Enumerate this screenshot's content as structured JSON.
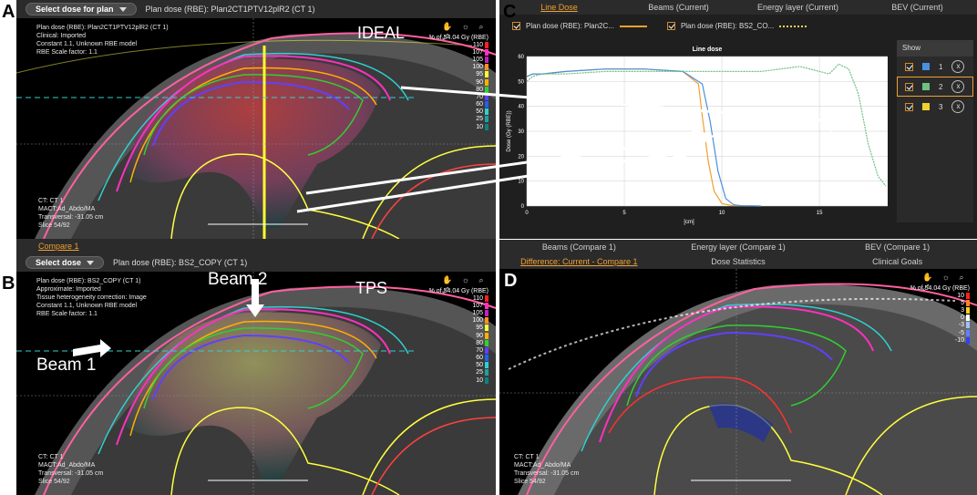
{
  "panel_letters": {
    "a": "A",
    "b": "B",
    "c": "C",
    "d": "D"
  },
  "panel_a": {
    "select_button": "Select dose for plan",
    "dose_title": "Plan dose (RBE): Plan2CT1PTV12plR2 (CT 1)",
    "info_lines": [
      "Plan dose (RBE): Plan2CT1PTV12plR2 (CT 1)",
      "Clinical: Imported",
      "Constant 1.1, Unknown RBE model",
      "RBE Scale factor: 1.1"
    ],
    "label": "IDEAL",
    "percent_of": "% of 54.04 Gy (RBE)",
    "bottom_lines": [
      "CT: CT 1",
      "MACT:Ad_Abdo/MA",
      "Transversal: -31.05 cm",
      "Slice 54/92"
    ]
  },
  "panel_b": {
    "compare_tab": "Compare 1",
    "select_button": "Select dose",
    "dose_title": "Plan dose (RBE): BS2_COPY (CT 1)",
    "info_lines": [
      "Plan dose (RBE): BS2_COPY (CT 1)",
      "Approximate: Imported",
      "Tissue heterogeneity correction: Image",
      "Constant 1.1, Unknown RBE model",
      "RBE Scale factor: 1.1"
    ],
    "label": "TPS",
    "beam1": "Beam 1",
    "beam2": "Beam 2",
    "percent_of": "% of 54.04 Gy (RBE)",
    "bottom_lines": [
      "CT: CT 1",
      "MACT:Ad_Abdo/MA",
      "Transversal: -31.05 cm",
      "Slice 54/92"
    ]
  },
  "panel_d": {
    "percent_of": "% of 54.04 Gy (RBE)",
    "bottom_lines": [
      "CT: CT 1",
      "MACT:Ad_Abdo/MA",
      "Transversal: -31.05 cm",
      "Slice 54/92"
    ]
  },
  "dose_legend": {
    "levels": [
      "110",
      "107",
      "105",
      "100",
      "95",
      "90",
      "80",
      "70",
      "60",
      "50",
      "25",
      "10"
    ],
    "colors": [
      "#ff2020",
      "#ff30c0",
      "#c020c0",
      "#ff9020",
      "#ffff30",
      "#ffb000",
      "#30d030",
      "#6040ff",
      "#2060ff",
      "#30d0d0",
      "#20a0a0",
      "#108080"
    ]
  },
  "diff_legend": {
    "levels": [
      "10",
      "5",
      "3",
      "0",
      "-3",
      "-5",
      "-10"
    ],
    "colors": [
      "#ff2020",
      "#ff8020",
      "#ffd020",
      "#ffffff",
      "#a0c0ff",
      "#6080ff",
      "#3040ff"
    ]
  },
  "tabs_top": [
    "Line Dose",
    "Beams (Current)",
    "Energy layer (Current)",
    "BEV (Current)"
  ],
  "tabs_mid": [
    "Beams (Compare 1)",
    "Energy layer (Compare 1)",
    "BEV (Compare 1)"
  ],
  "tabs_bottom": [
    "Difference: Current - Compare 1",
    "Dose Statistics",
    "Clinical Goals"
  ],
  "series_legend": [
    {
      "label": "Plan dose (RBE): Plan2C...",
      "color": "#f0a030"
    },
    {
      "label": "Plan dose (RBE): BS2_CO...",
      "color": "#f5d060"
    }
  ],
  "show_table": {
    "header": "Show",
    "rows": [
      {
        "num": "1",
        "color": "#4a90e0"
      },
      {
        "num": "2",
        "color": "#70c080"
      },
      {
        "num": "3",
        "color": "#f0d030"
      }
    ]
  },
  "chart_data": {
    "type": "line",
    "title": "Line dose",
    "xlabel": "[cm]",
    "ylabel": "Dose (Gy (RBE))",
    "xlim": [
      0,
      18.5
    ],
    "ylim": [
      0,
      60
    ],
    "xticks": [
      0,
      5,
      10,
      15
    ],
    "yticks": [
      0,
      10,
      20,
      30,
      40,
      50,
      60
    ],
    "series": [
      {
        "color": "#f0a030",
        "x": [
          0,
          0.3,
          0.8,
          2,
          4,
          6,
          8,
          8.8,
          9.0,
          9.3,
          9.6,
          10.0,
          10.5,
          12
        ],
        "y": [
          52,
          53,
          53,
          54,
          55,
          55,
          54,
          49,
          36,
          18,
          6,
          1,
          0.2,
          0
        ]
      },
      {
        "color": "#4a90e0",
        "x": [
          0,
          0.3,
          0.8,
          2,
          4,
          6,
          8,
          9.0,
          9.4,
          9.8,
          10.2,
          10.6,
          11,
          12
        ],
        "y": [
          52,
          53,
          53,
          54,
          55,
          55,
          54,
          49,
          34,
          14,
          3,
          0.5,
          0.1,
          0
        ]
      },
      {
        "color": "#70c080",
        "x": [
          0,
          0.3,
          0.8,
          2,
          4,
          6,
          8,
          10,
          12,
          14,
          15.5,
          16.0,
          16.5,
          17.0,
          17.5,
          18,
          18.4
        ],
        "y": [
          50,
          52,
          53,
          53,
          54,
          54,
          54,
          54,
          54,
          56,
          53,
          57,
          55,
          45,
          25,
          12,
          8
        ]
      }
    ]
  }
}
